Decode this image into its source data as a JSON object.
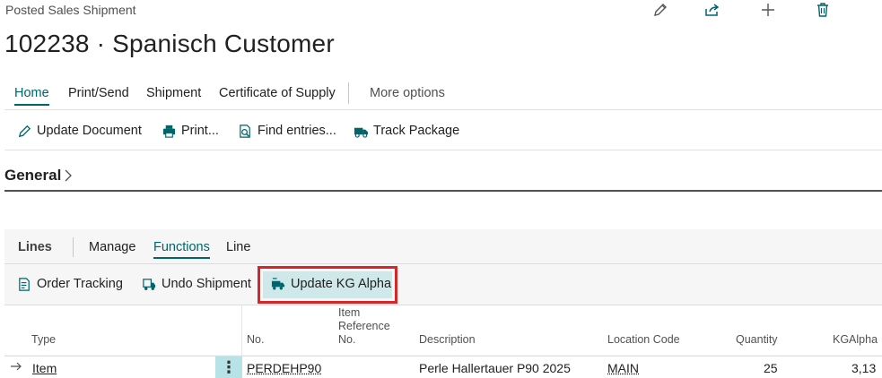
{
  "header": {
    "caption": "Posted Sales Shipment",
    "title": "102238 · Spanisch Customer"
  },
  "tabs": [
    "Home",
    "Print/Send",
    "Shipment",
    "Certificate of Supply",
    "More options"
  ],
  "actions": [
    "Update Document",
    "Print...",
    "Find entries...",
    "Track Package"
  ],
  "general": {
    "label": "General"
  },
  "lines": {
    "title": "Lines",
    "tabs": [
      "Manage",
      "Functions",
      "Line"
    ],
    "actions": [
      "Order Tracking",
      "Undo Shipment",
      "Update KG Alpha"
    ],
    "columns": {
      "type": "Type",
      "no": "No.",
      "item_ref_1": "Item",
      "item_ref_2": "Reference",
      "item_ref_3": "No.",
      "description": "Description",
      "location": "Location Code",
      "quantity": "Quantity",
      "kgalpha": "KGAlpha"
    },
    "rows": [
      {
        "type": "Item",
        "no": "PERDEHP90",
        "item_ref": "",
        "description": "Perle Hallertauer P90 2025",
        "location": "MAIN",
        "quantity": "25",
        "kgalpha": "3,13"
      }
    ]
  },
  "colors": {
    "accent": "#00656b",
    "highlight": "#d62728",
    "selected": "#b8e3e6"
  }
}
